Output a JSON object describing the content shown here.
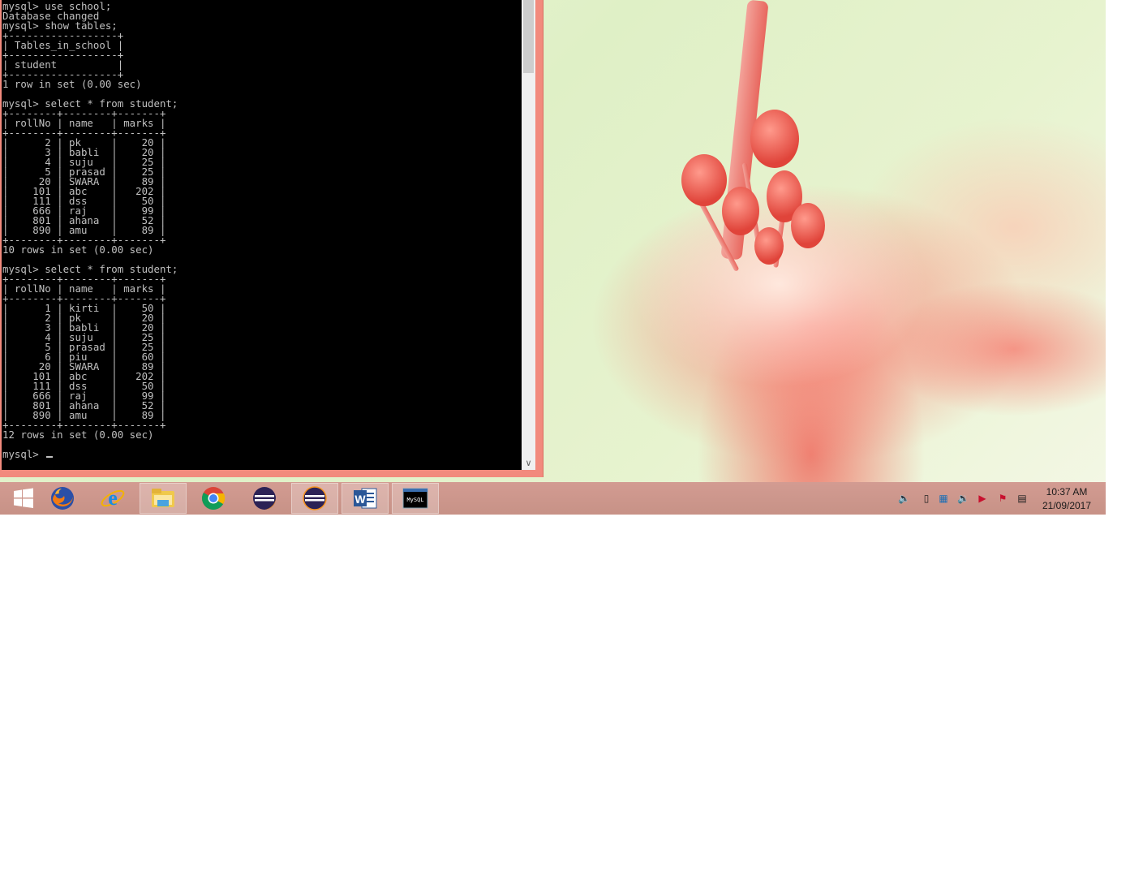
{
  "console": {
    "lines": [
      "mysql> use school;",
      "Database changed",
      "mysql> show tables;",
      "+------------------+",
      "| Tables_in_school |",
      "+------------------+",
      "| student          |",
      "+------------------+",
      "1 row in set (0.00 sec)",
      "",
      "mysql> select * from student;",
      "+--------+--------+-------+",
      "| rollNo | name   | marks |",
      "+--------+--------+-------+",
      "|      2 | pk     |    20 |",
      "|      3 | babli  |    20 |",
      "|      4 | suju   |    25 |",
      "|      5 | prasad |    25 |",
      "|     20 | SWARA  |    89 |",
      "|    101 | abc    |   202 |",
      "|    111 | dss    |    50 |",
      "|    666 | raj    |    99 |",
      "|    801 | ahana  |    52 |",
      "|    890 | amu    |    89 |",
      "+--------+--------+-------+",
      "10 rows in set (0.00 sec)",
      "",
      "mysql> select * from student;",
      "+--------+--------+-------+",
      "| rollNo | name   | marks |",
      "+--------+--------+-------+",
      "|      1 | kirti  |    50 |",
      "|      2 | pk     |    20 |",
      "|      3 | babli  |    20 |",
      "|      4 | suju   |    25 |",
      "|      5 | prasad |    25 |",
      "|      6 | piu    |    60 |",
      "|     20 | SWARA  |    89 |",
      "|    101 | abc    |   202 |",
      "|    111 | dss    |    50 |",
      "|    666 | raj    |    99 |",
      "|    801 | ahana  |    52 |",
      "|    890 | amu    |    89 |",
      "+--------+--------+-------+",
      "12 rows in set (0.00 sec)",
      "",
      "mysql> "
    ]
  },
  "taskbar": {
    "apps": [
      {
        "name": "start-button",
        "icon": "windows-logo-icon"
      },
      {
        "name": "firefox",
        "icon": "firefox-icon"
      },
      {
        "name": "internet-explorer",
        "icon": "internet-explorer-icon"
      },
      {
        "name": "file-explorer",
        "icon": "folder-icon"
      },
      {
        "name": "chrome",
        "icon": "chrome-icon"
      },
      {
        "name": "eclipse",
        "icon": "eclipse-icon"
      },
      {
        "name": "eclipse-2",
        "icon": "eclipse-icon"
      },
      {
        "name": "word",
        "icon": "word-icon"
      },
      {
        "name": "mysql-console",
        "icon": "mysql-console-icon"
      }
    ],
    "mysql_icon_text": "MySQL",
    "word_icon_text": "W",
    "tray_icons": [
      "speaker-icon",
      "battery-icon",
      "network-icon",
      "volume-icon",
      "adobe-icon",
      "flag-icon",
      "signal-icon"
    ],
    "clock": {
      "time": "10:37 AM",
      "date": "21/09/2017"
    }
  },
  "colors": {
    "console_bg": "#000000",
    "console_text": "#c0c0c0",
    "window_frame": "#f28a7d"
  }
}
